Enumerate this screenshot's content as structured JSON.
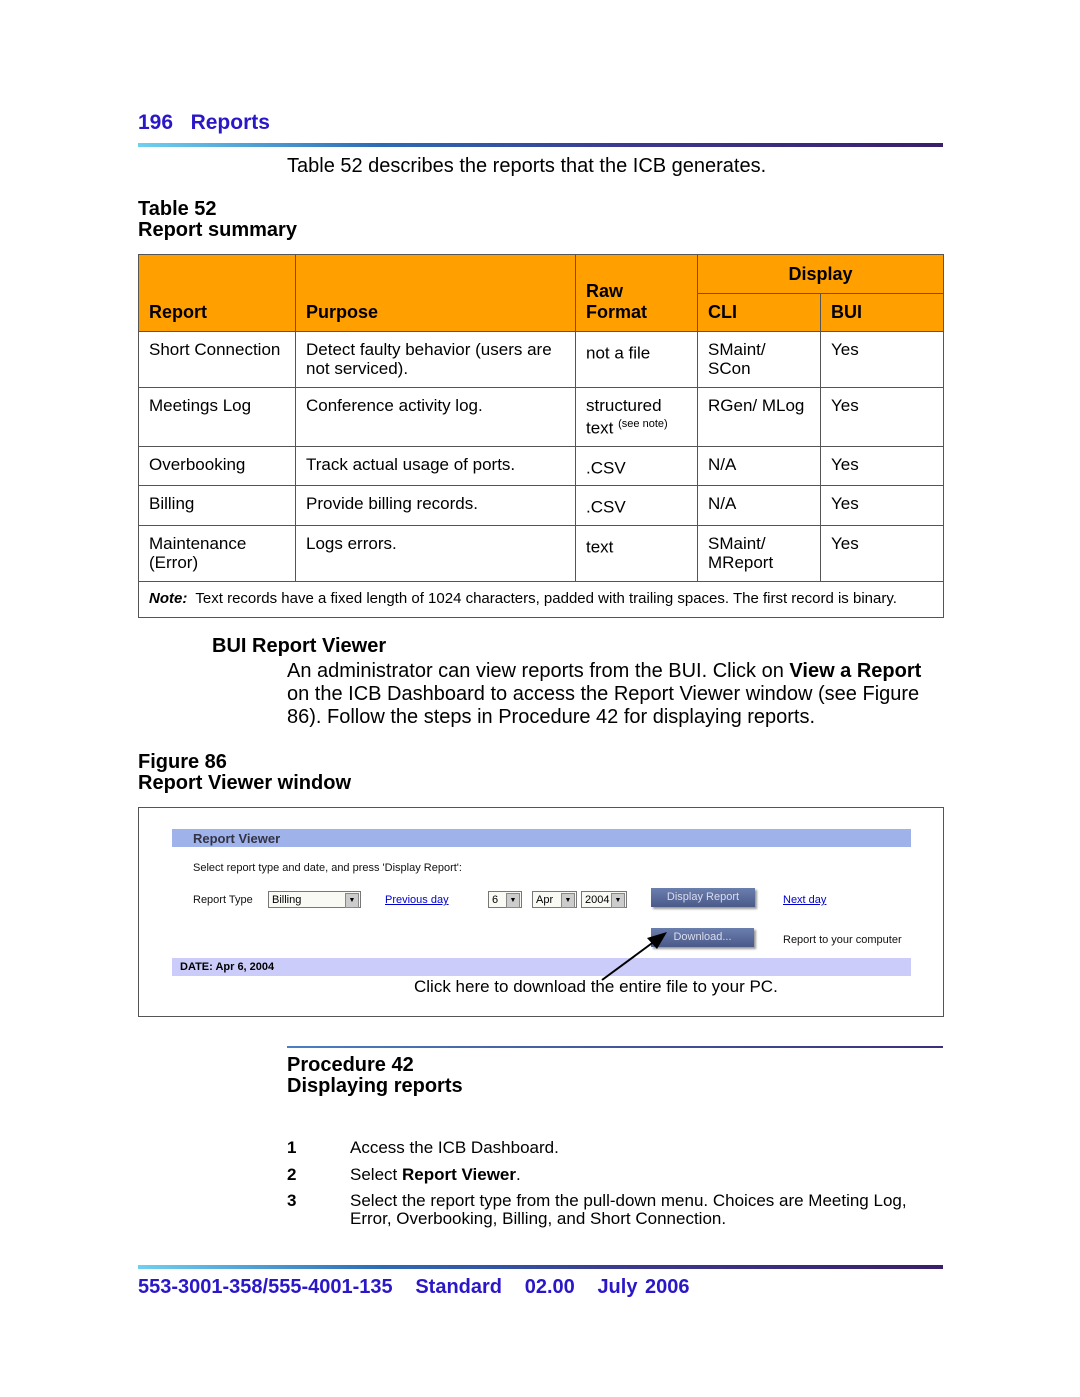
{
  "header": {
    "page_number": "196",
    "section": "Reports"
  },
  "intro": "Table 52 describes the reports that the ICB generates.",
  "table": {
    "label": "Table 52",
    "title": "Report summary",
    "headers": {
      "report": "Report",
      "purpose": "Purpose",
      "raw_format": "Raw Format",
      "display": "Display",
      "cli": "CLI",
      "bui": "BUI"
    },
    "rows": [
      {
        "report": "Short Connection",
        "purpose": "Detect faulty behavior (users are not serviced).",
        "raw": "not a file",
        "raw_note": "",
        "cli": "SMaint/ SCon",
        "bui": "Yes"
      },
      {
        "report": "Meetings Log",
        "purpose": "Conference activity log.",
        "raw": "structured text",
        "raw_note": "(see note)",
        "cli": "RGen/ MLog",
        "bui": "Yes"
      },
      {
        "report": "Overbooking",
        "purpose": "Track actual usage of ports.",
        "raw": ".CSV",
        "raw_note": "",
        "cli": "N/A",
        "bui": "Yes"
      },
      {
        "report": "Billing",
        "purpose": "Provide billing records.",
        "raw": ".CSV",
        "raw_note": "",
        "cli": "N/A",
        "bui": "Yes"
      },
      {
        "report": "Maintenance (Error)",
        "purpose": "Logs errors.",
        "raw": "text",
        "raw_note": "",
        "cli": "SMaint/ MReport",
        "bui": "Yes"
      }
    ],
    "note_label": "Note:",
    "note": "Text records have a fixed length of 1024 characters, padded with trailing spaces. The first record is binary."
  },
  "bui": {
    "heading": "BUI Report Viewer",
    "p1": "An administrator can view reports from the BUI. Click on ",
    "bold": "View a Report",
    "p2": " on the ICB Dashboard to access the Report Viewer window (see Figure 86). Follow the steps in Procedure 42 for displaying reports."
  },
  "figure": {
    "label": "Figure 86",
    "title": "Report Viewer window",
    "viewer": {
      "title": "Report Viewer",
      "instruction": "Select report type and date, and press 'Display Report':",
      "report_type_label": "Report Type",
      "report_type": "Billing",
      "previous_day": "Previous day",
      "day": "6",
      "month": "Apr",
      "year": "2004",
      "display_button": "Display Report",
      "next_day": "Next day",
      "download_button": "Download...",
      "download_label": "Report to your computer",
      "date_bar": "DATE: Apr 6, 2004"
    },
    "callout": "Click here to download the entire file to your PC."
  },
  "procedure": {
    "label": "Procedure 42",
    "title": "Displaying reports",
    "steps": [
      {
        "n": "1",
        "pre": "Access the ICB Dashboard.",
        "bold": "",
        "post": ""
      },
      {
        "n": "2",
        "pre": "Select ",
        "bold": "Report Viewer",
        "post": "."
      },
      {
        "n": "3",
        "pre": "Select the report type from the pull-down menu. Choices are Meeting Log, Error, Overbooking, Billing, and Short Connection.",
        "bold": "",
        "post": ""
      }
    ]
  },
  "footer": {
    "doc": "553-3001-358/555-4001-135",
    "status": "Standard",
    "version": "02.00",
    "date": "July 2006"
  }
}
